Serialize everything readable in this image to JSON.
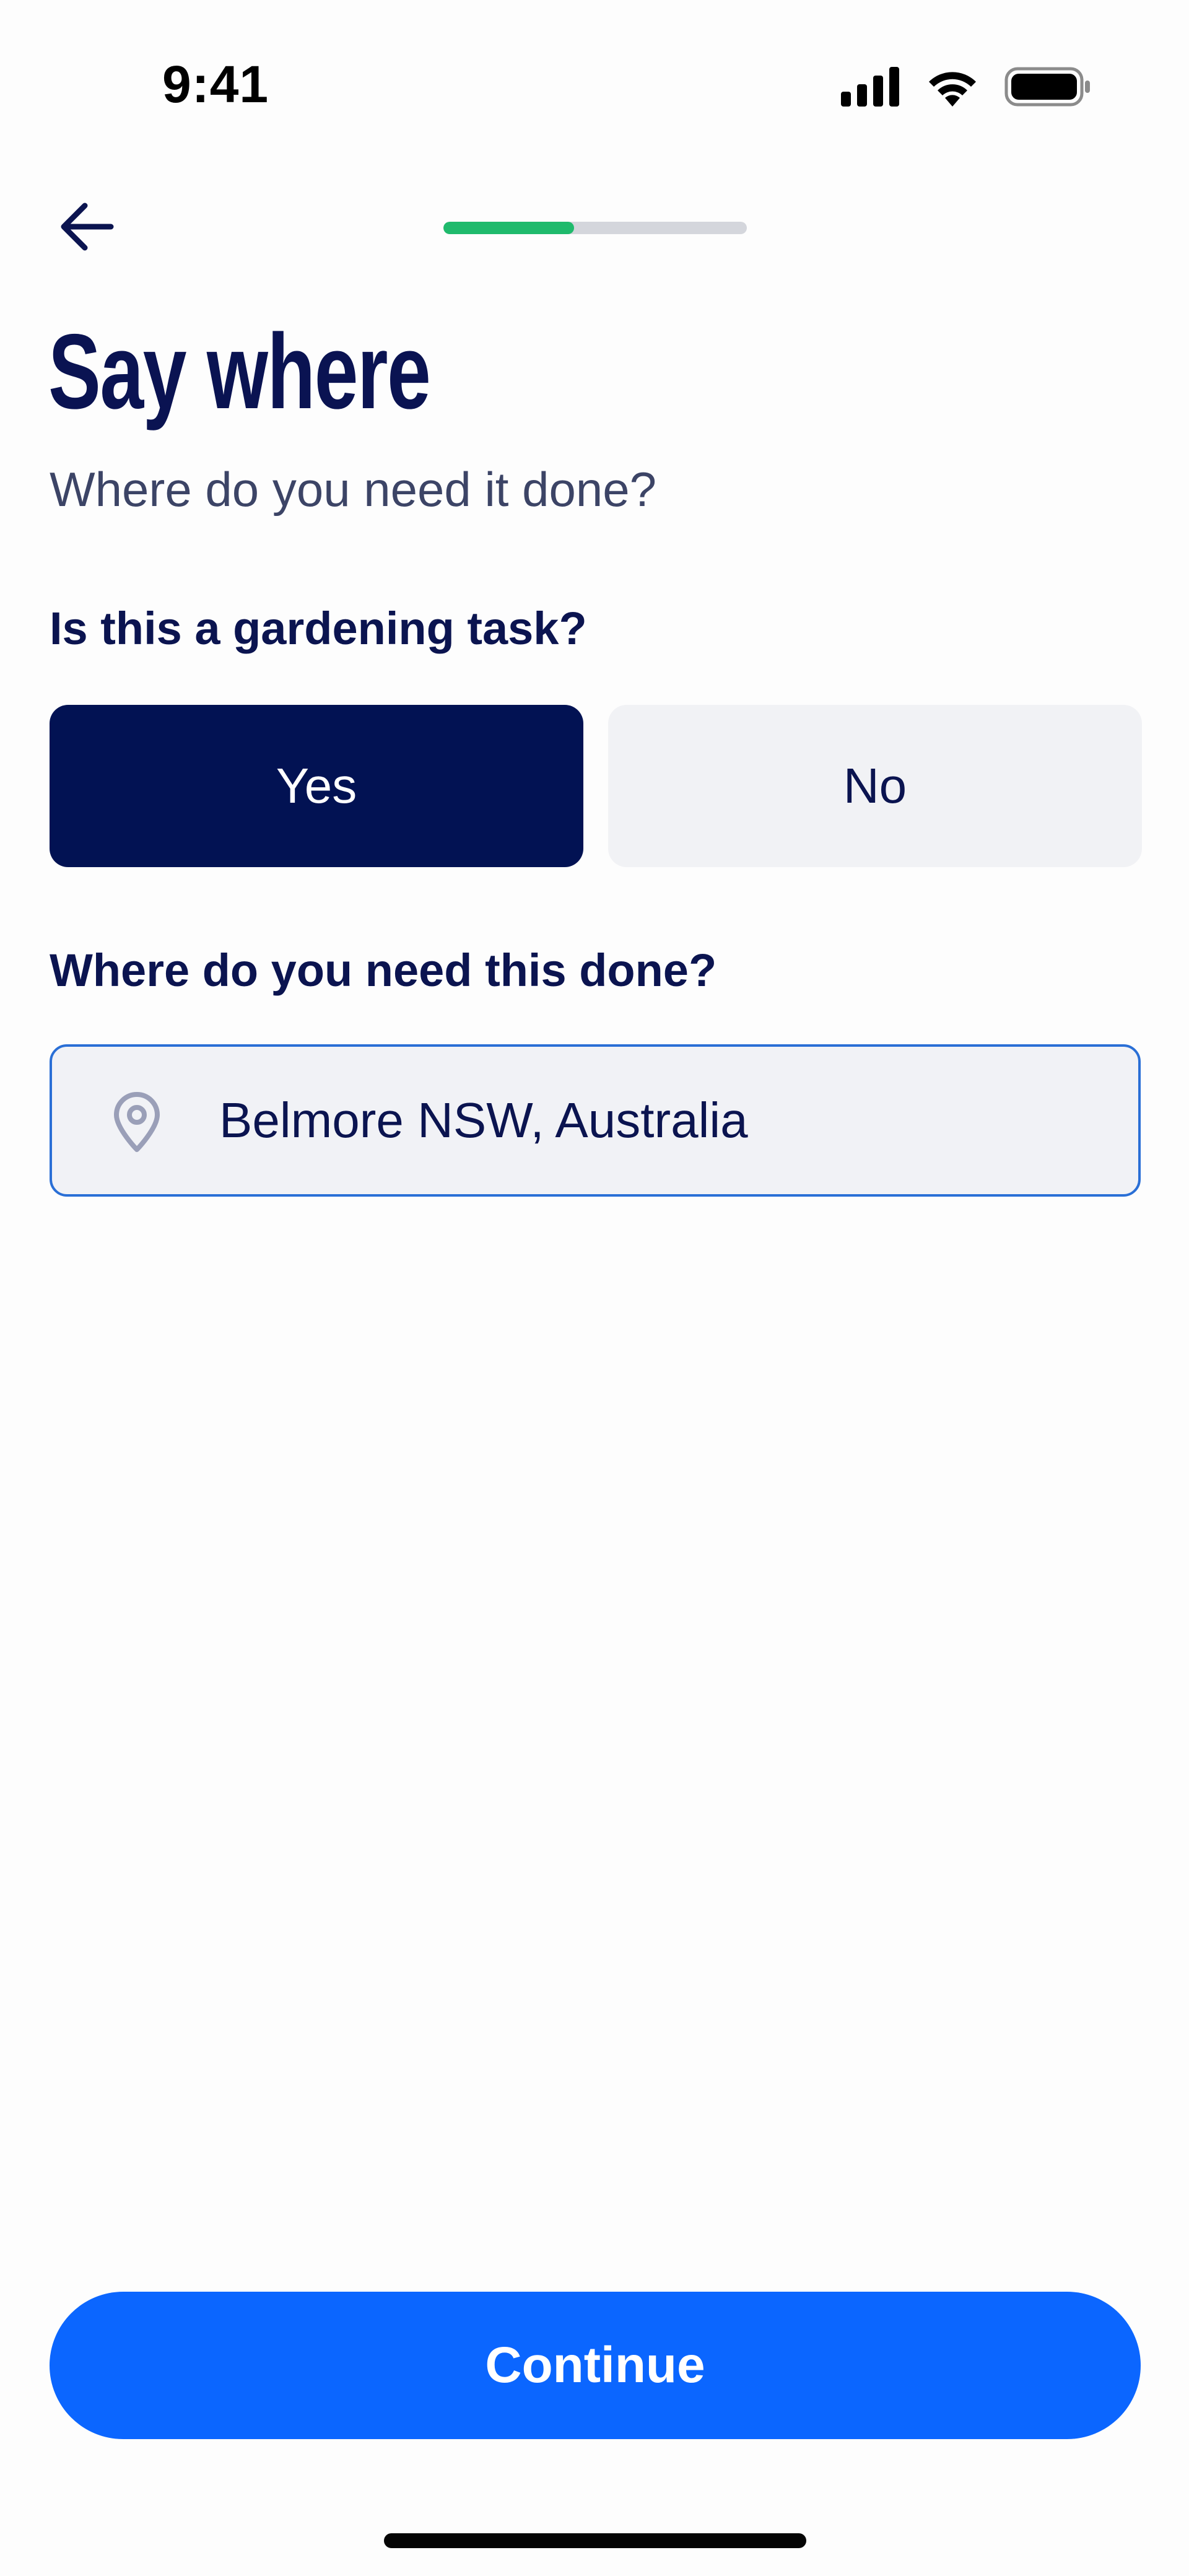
{
  "status_bar": {
    "time": "9:41",
    "icons": [
      "cellular-signal-icon",
      "wifi-icon",
      "battery-icon"
    ]
  },
  "header": {
    "back_icon": "arrow-left-icon",
    "progress_fraction": 0.43
  },
  "title": "Say where",
  "subtitle": "Where do you need it done?",
  "gardening_question": {
    "label": "Is this a gardening task?",
    "options": [
      "Yes",
      "No"
    ],
    "selected": "Yes"
  },
  "location_question": {
    "label": "Where do you need this done?",
    "icon": "location-pin-icon",
    "value": "Belmore NSW, Australia"
  },
  "continue_label": "Continue",
  "colors": {
    "primary_navy": "#021253",
    "accent_blue": "#0b66ff",
    "progress_green": "#1fba6c",
    "input_border": "#2a6fd6",
    "unselected_bg": "#f1f2f5"
  }
}
